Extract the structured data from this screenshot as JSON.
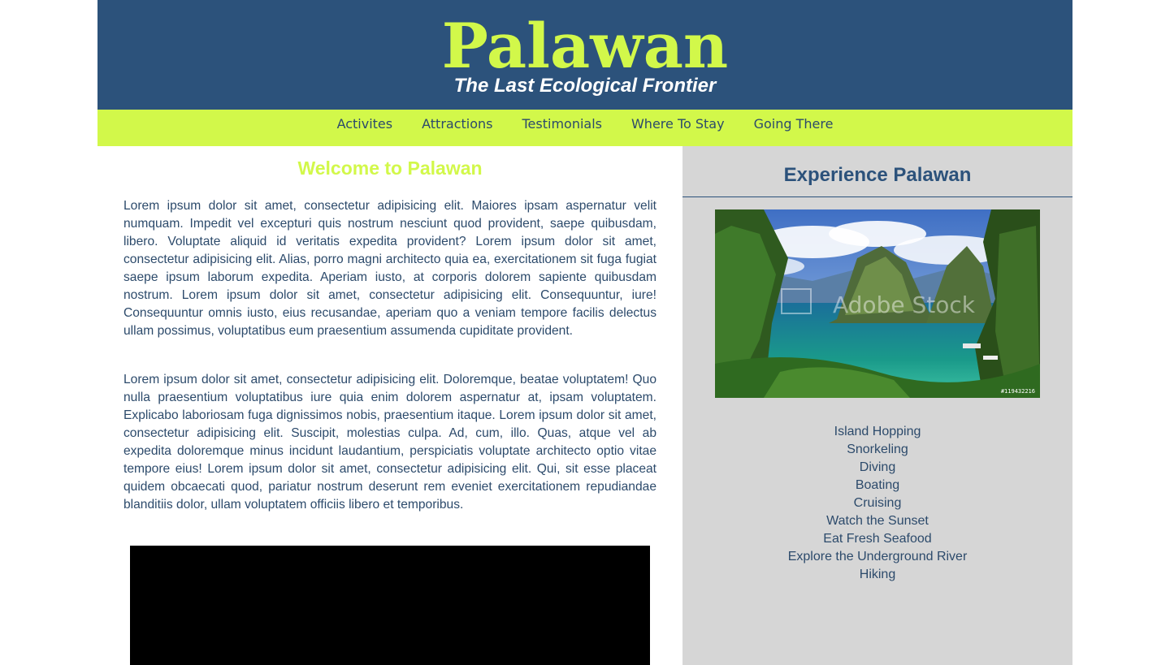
{
  "header": {
    "title": "Palawan",
    "tagline": "The Last Ecological Frontier"
  },
  "nav": {
    "items": [
      "Activites",
      "Attractions",
      "Testimonials",
      "Where To Stay",
      "Going There"
    ]
  },
  "main": {
    "heading": "Welcome to Palawan",
    "paragraphs": [
      "Lorem ipsum dolor sit amet, consectetur adipisicing elit. Maiores ipsam aspernatur velit numquam. Impedit vel excepturi quis nostrum nesciunt quod provident, saepe quibusdam, libero. Voluptate aliquid id veritatis expedita provident? Lorem ipsum dolor sit amet, consectetur adipisicing elit. Alias, porro magni architecto quia ea, exercitationem sit fuga fugiat saepe ipsum laborum expedita. Aperiam iusto, at corporis dolorem sapiente quibusdam nostrum. Lorem ipsum dolor sit amet, consectetur adipisicing elit. Consequuntur, iure! Consequuntur omnis iusto, eius recusandae, aperiam quo a veniam tempore facilis delectus ullam possimus, voluptatibus eum praesentium assumenda cupiditate provident.",
      "Lorem ipsum dolor sit amet, consectetur adipisicing elit. Doloremque, beatae voluptatem! Quo nulla praesentium voluptatibus iure quia enim dolorem aspernatur at, ipsam voluptatem. Explicabo laboriosam fuga dignissimos nobis, praesentium itaque. Lorem ipsum dolor sit amet, consectetur adipisicing elit. Suscipit, molestias culpa. Ad, cum, illo. Quas, atque vel ab expedita doloremque minus incidunt laudantium, perspiciatis voluptate architecto optio vitae tempore eius! Lorem ipsum dolor sit amet, consectetur adipisicing elit. Qui, sit esse placeat quidem obcaecati quod, pariatur nostrum deserunt rem eveniet exercitationem repudiandae blanditiis dolor, ullam voluptatem officiis libero et temporibus."
    ]
  },
  "aside": {
    "heading": "Experience Palawan",
    "photo": {
      "watermark": "Adobe Stock",
      "stock_id": "#119432216"
    },
    "activities": [
      "Island Hopping",
      "Snorkeling",
      "Diving",
      "Boating",
      "Cruising",
      "Watch the Sunset",
      "Eat Fresh Seafood",
      "Explore the Underground River",
      "Hiking"
    ]
  },
  "colors": {
    "header_bg": "#2c527b",
    "accent_lime": "#d2f84a",
    "text_navy": "#2c4a6b",
    "aside_bg": "#d6d6d6"
  }
}
